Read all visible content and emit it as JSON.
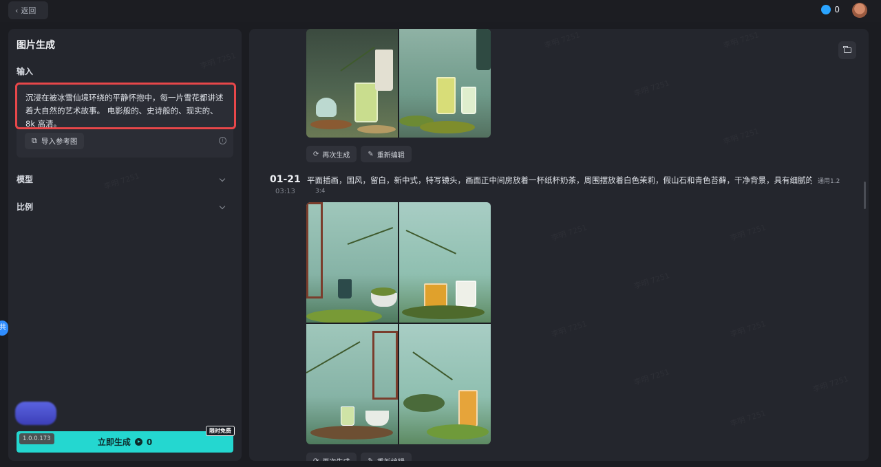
{
  "topbar": {
    "back_label": "返回",
    "credits": "0"
  },
  "left": {
    "title": "图片生成",
    "input_label": "输入",
    "prompt": "沉浸在被冰雪仙境环绕的平静怀抱中，每一片雪花都讲述着大自然的艺术故事。 电影般的、史诗般的、现实的、8k 高清。",
    "ref_button": "导入参考图",
    "model_label": "模型",
    "ratio_label": "比例",
    "version": "1.0.0.173",
    "generate_label": "立即生成",
    "generate_cost": "0",
    "free_badge": "限时免费",
    "side_tab": "共"
  },
  "right": {
    "actions": {
      "regenerate": "再次生成",
      "reedit": "重新编辑"
    },
    "item2": {
      "date": "01-21",
      "time": "03:13",
      "prompt": "平面插画，国风，留白，新中式，特写镜头，画面正中间房放着一杯纸杯奶茶，周围摆放着白色茉莉，假山石和青色苔藓，干净背景，具有细腻的笔触",
      "model": "通用1.2",
      "ratio": "3:4"
    }
  },
  "watermark": "李明 7251"
}
